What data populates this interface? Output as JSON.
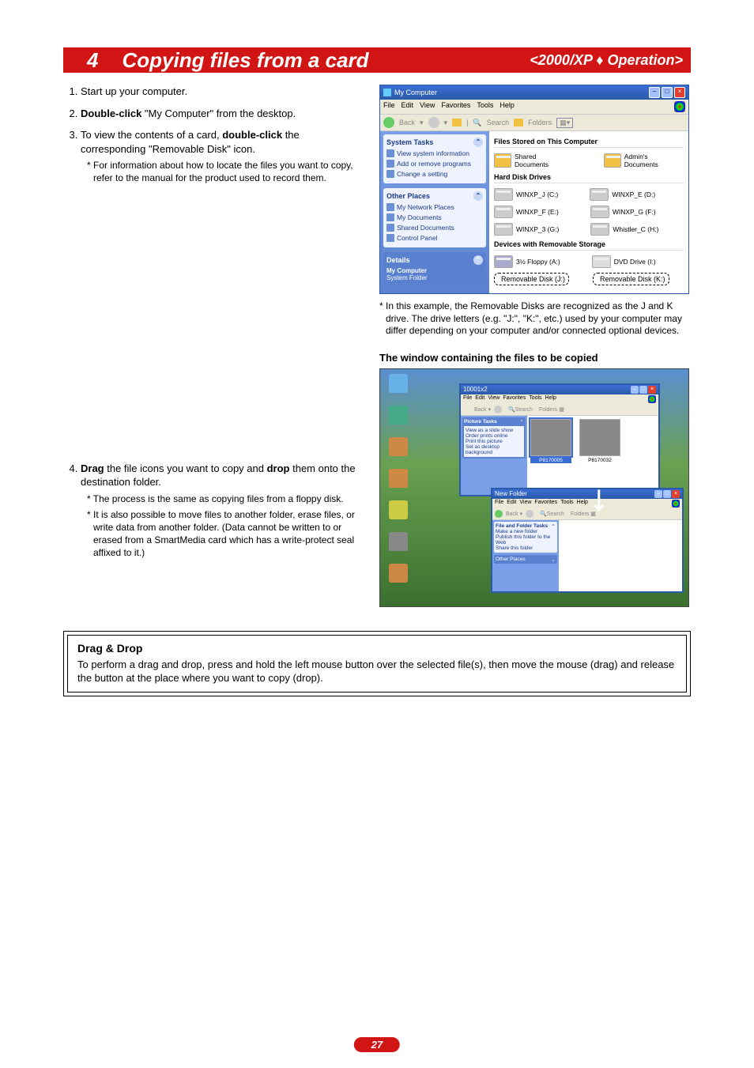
{
  "banner": {
    "number": "4",
    "title": "Copying files from a card",
    "right": "<2000/XP ♦ Operation>"
  },
  "steps": {
    "s1": {
      "text": "Start up your computer."
    },
    "s2": {
      "bold": "Double-click",
      "rest": " \"My Computer\" from the desktop."
    },
    "s3": {
      "p1a": "To view the contents of a card, ",
      "p1b": "double-click",
      "p1c": " the corresponding \"Removable Disk\" icon.",
      "note": "* For information about how to locate the files you want to copy, refer to the manual for the product used to record them."
    },
    "s4": {
      "w1": "Drag",
      "mid": " the file icons you want to copy and ",
      "w2": "drop",
      "end": " them onto the destination folder.",
      "note1": "* The process is the same as copying files from a floppy disk.",
      "note2": "* It is also possible to move files to another folder, erase files, or write data from another folder. (Data cannot be written to or erased from a SmartMedia card which has a write-protect seal affixed to it.)"
    }
  },
  "mycomputer": {
    "title": "My Computer",
    "menus": [
      "File",
      "Edit",
      "View",
      "Favorites",
      "Tools",
      "Help"
    ],
    "toolbar": {
      "back": "Back",
      "search": "Search",
      "folders": "Folders"
    },
    "sidebar": {
      "system_tasks": {
        "title": "System Tasks",
        "links": [
          "View system information",
          "Add or remove programs",
          "Change a setting"
        ]
      },
      "other_places": {
        "title": "Other Places",
        "links": [
          "My Network Places",
          "My Documents",
          "Shared Documents",
          "Control Panel"
        ]
      },
      "details": {
        "title": "Details",
        "line1": "My Computer",
        "line2": "System Folder"
      }
    },
    "sections": {
      "files_stored": "Files Stored on This Computer",
      "shared_docs": "Shared Documents",
      "admin_docs": "Admin's Documents",
      "hdd": "Hard Disk Drives",
      "drives": [
        "WINXP_J (C:)",
        "WINXP_E (D:)",
        "WINXP_F (E:)",
        "WINXP_G (F:)",
        "WINXP_3 (G:)",
        "Whistler_C (H:)"
      ],
      "removable": "Devices with Removable Storage",
      "floppy": "3½ Floppy (A:)",
      "dvd": "DVD Drive (I:)",
      "rem1": "Removable Disk (J:)",
      "rem2": "Removable Disk (K:)"
    }
  },
  "caption1": "* In this example, the Removable Disks are recognized as the J and K drive. The drive letters (e.g. \"J:\", \"K:\", etc.) used by your computer may differ depending on your computer and/or connected optional devices.",
  "subhead": "The window containing the files to be copied",
  "desktop": {
    "win1": {
      "title": "10001x2",
      "menus": [
        "File",
        "Edit",
        "View",
        "Favorites",
        "Tools",
        "Help"
      ],
      "tasks_title": "Picture Tasks",
      "tasks": [
        "View as a slide show",
        "Order prints online",
        "Print this picture",
        "Set as desktop background"
      ],
      "img1": "P8170005",
      "img2": "P8170032"
    },
    "win2": {
      "title": "New Folder",
      "menus": [
        "File",
        "Edit",
        "View",
        "Favorites",
        "Tools",
        "Help"
      ],
      "tasks_title": "File and Folder Tasks",
      "tasks": [
        "Make a new folder",
        "Publish this folder to the Web",
        "Share this folder"
      ],
      "other": "Other Places"
    }
  },
  "dragdrop": {
    "title": "Drag & Drop",
    "body": "To perform a drag and drop, press and hold the left mouse button over the selected file(s), then move the mouse (drag) and release the button at the place where you want to copy (drop)."
  },
  "pagenum": "27"
}
